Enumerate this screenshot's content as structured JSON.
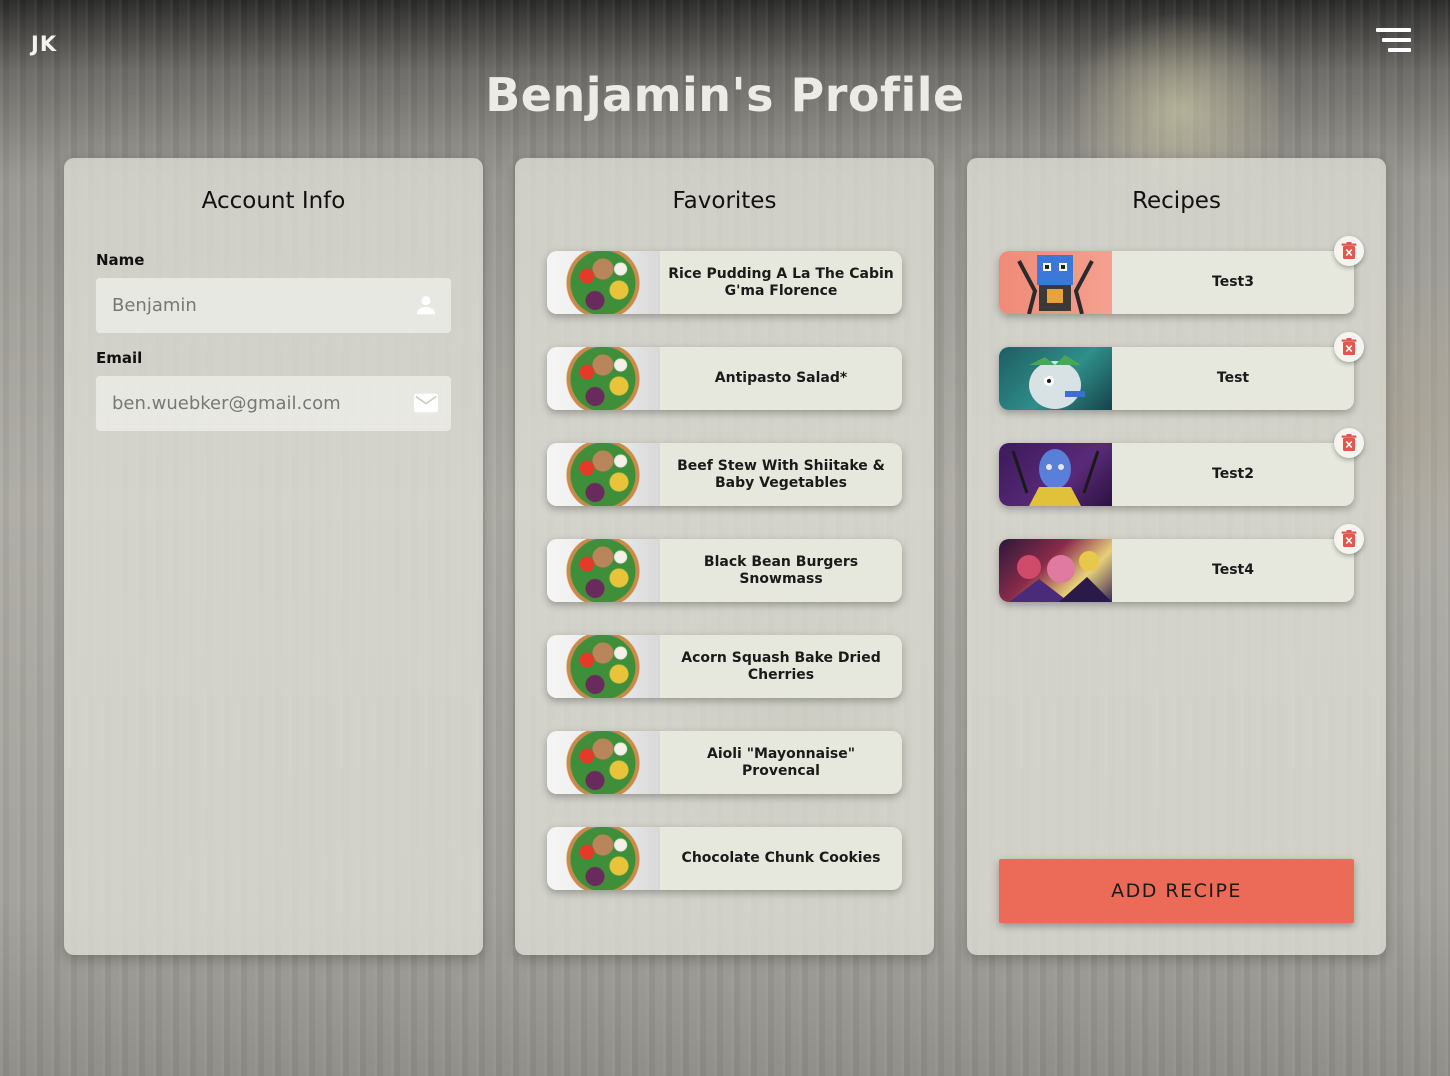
{
  "app": {
    "logo": "JK",
    "menu_icon": "hamburger-menu-icon"
  },
  "page": {
    "title": "Benjamin's Profile"
  },
  "account": {
    "title": "Account Info",
    "name_label": "Name",
    "name_value": "Benjamin",
    "name_icon": "person-icon",
    "email_label": "Email",
    "email_value": "ben.wuebker@gmail.com",
    "email_icon": "mail-icon"
  },
  "favorites": {
    "title": "Favorites",
    "items": [
      {
        "label": "Rice Pudding A La The Cabin G'ma Florence"
      },
      {
        "label": "Antipasto Salad*"
      },
      {
        "label": "Beef Stew With Shiitake & Baby Vegetables"
      },
      {
        "label": "Black Bean Burgers Snowmass"
      },
      {
        "label": "Acorn Squash Bake Dried Cherries"
      },
      {
        "label": "Aioli \"Mayonnaise\" Provencal"
      },
      {
        "label": "Chocolate Chunk Cookies"
      }
    ]
  },
  "recipes": {
    "title": "Recipes",
    "items": [
      {
        "label": "Test3"
      },
      {
        "label": "Test"
      },
      {
        "label": "Test2"
      },
      {
        "label": "Test4"
      }
    ],
    "delete_icon": "trash-icon",
    "add_label": "ADD RECIPE"
  },
  "colors": {
    "accent": "#ec6a58",
    "card_bg": "#e6e8dd",
    "trash_red": "#e2574c"
  }
}
